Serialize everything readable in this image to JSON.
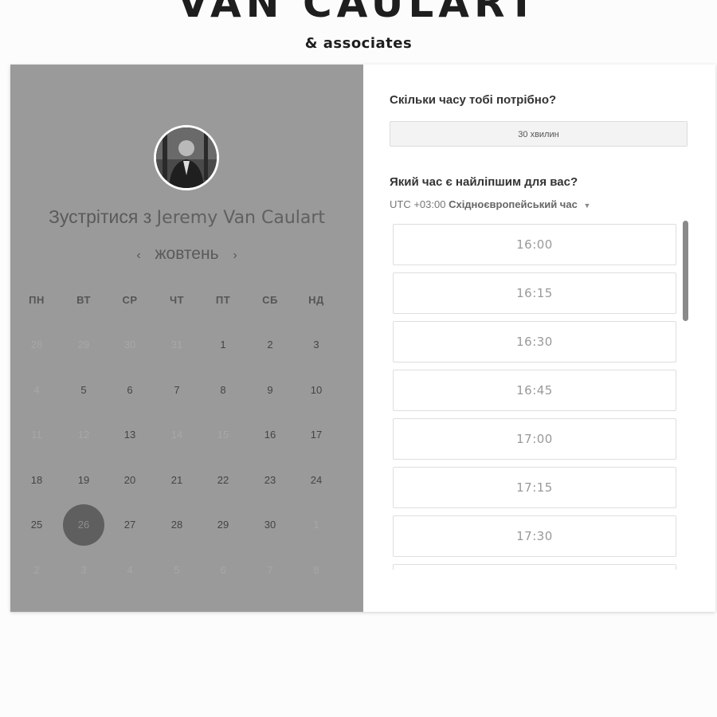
{
  "brand": {
    "title": "VAN CAULART",
    "subtitle": "& associates"
  },
  "profile": {
    "meet_prefix": "Зустрітися з",
    "meet_name": "Jeremy Van Caulart",
    "avatar_icon": "person-photo-icon"
  },
  "calendar": {
    "month": "жовтень",
    "prev_icon": "‹",
    "next_icon": "›",
    "weekdays": [
      "ПН",
      "ВТ",
      "СР",
      "ЧТ",
      "ПТ",
      "СБ",
      "НД"
    ],
    "weeks": [
      [
        {
          "d": "28",
          "muted": true
        },
        {
          "d": "29",
          "muted": true
        },
        {
          "d": "30",
          "muted": true
        },
        {
          "d": "31",
          "muted": true
        },
        {
          "d": "1"
        },
        {
          "d": "2"
        },
        {
          "d": "3"
        }
      ],
      [
        {
          "d": "4",
          "muted": true
        },
        {
          "d": "5"
        },
        {
          "d": "6"
        },
        {
          "d": "7"
        },
        {
          "d": "8"
        },
        {
          "d": "9"
        },
        {
          "d": "10"
        }
      ],
      [
        {
          "d": "11",
          "muted": true
        },
        {
          "d": "12",
          "muted": true
        },
        {
          "d": "13"
        },
        {
          "d": "14",
          "muted": true
        },
        {
          "d": "15",
          "muted": true
        },
        {
          "d": "16"
        },
        {
          "d": "17"
        }
      ],
      [
        {
          "d": "18"
        },
        {
          "d": "19"
        },
        {
          "d": "20"
        },
        {
          "d": "21"
        },
        {
          "d": "22"
        },
        {
          "d": "23"
        },
        {
          "d": "24"
        }
      ],
      [
        {
          "d": "25"
        },
        {
          "d": "26",
          "selected": true
        },
        {
          "d": "27"
        },
        {
          "d": "28"
        },
        {
          "d": "29"
        },
        {
          "d": "30"
        },
        {
          "d": "1",
          "muted": true
        }
      ],
      [
        {
          "d": "2",
          "muted": true
        },
        {
          "d": "3",
          "muted": true
        },
        {
          "d": "4",
          "muted": true
        },
        {
          "d": "5",
          "muted": true
        },
        {
          "d": "6",
          "muted": true
        },
        {
          "d": "7",
          "muted": true
        },
        {
          "d": "8",
          "muted": true
        }
      ]
    ]
  },
  "booking": {
    "duration_question": "Скільки часу тобі потрібно?",
    "duration_value": "30 хвилин",
    "time_question": "Який час є найліпшим для вас?",
    "tz_offset": "UTC +03:00",
    "tz_name": "Східноєвропейський час",
    "tz_caret": "▼",
    "slots": [
      "16:00",
      "16:15",
      "16:30",
      "16:45",
      "17:00",
      "17:15",
      "17:30",
      ""
    ]
  }
}
